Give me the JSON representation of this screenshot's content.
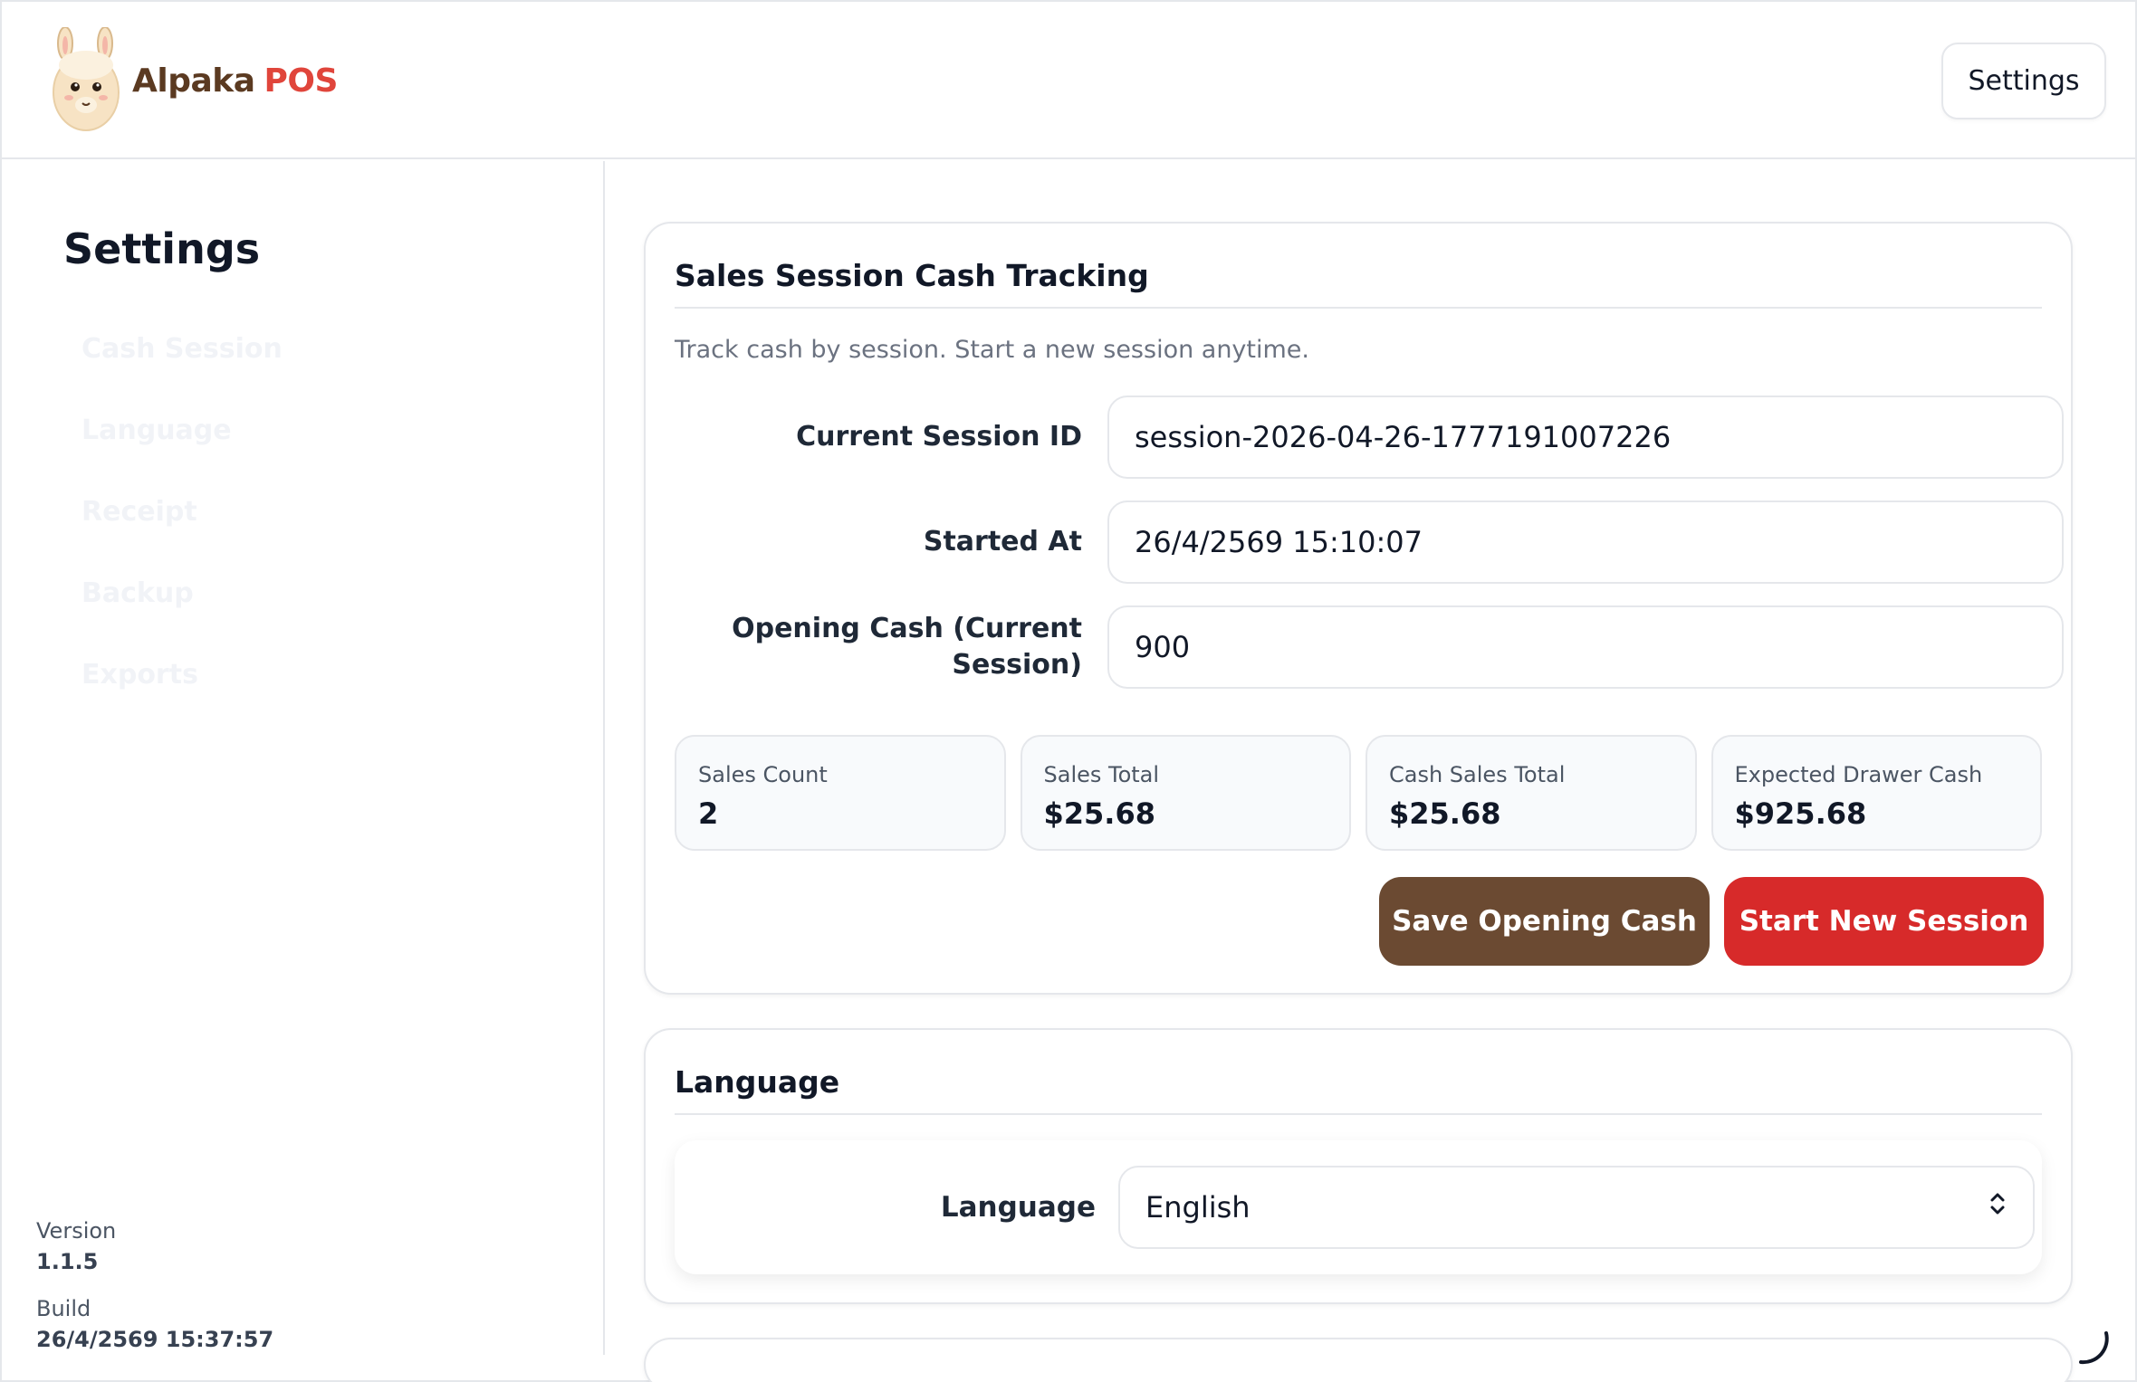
{
  "header": {
    "brand_primary": "Alpaka",
    "brand_secondary": "POS",
    "settings_button": "Settings"
  },
  "sidebar": {
    "title": "Settings",
    "items": [
      {
        "label": "Cash Session"
      },
      {
        "label": "Language"
      },
      {
        "label": "Receipt"
      },
      {
        "label": "Backup"
      },
      {
        "label": "Exports"
      }
    ],
    "version_label": "Version",
    "version_value": "1.1.5",
    "build_label": "Build",
    "build_value": "26/4/2569 15:37:57"
  },
  "cash_session": {
    "title": "Sales Session Cash Tracking",
    "description": "Track cash by session. Start a new session anytime.",
    "fields": {
      "session_id_label": "Current Session ID",
      "session_id_value": "session-2026-04-26-1777191007226",
      "started_at_label": "Started At",
      "started_at_value": "26/4/2569 15:10:07",
      "opening_cash_label": "Opening Cash (Current Session)",
      "opening_cash_value": "900"
    },
    "stats": [
      {
        "label": "Sales Count",
        "value": "2"
      },
      {
        "label": "Sales Total",
        "value": "$25.68"
      },
      {
        "label": "Cash Sales Total",
        "value": "$25.68"
      },
      {
        "label": "Expected Drawer Cash",
        "value": "$925.68"
      }
    ],
    "save_button": "Save Opening Cash",
    "start_button": "Start New Session"
  },
  "language_section": {
    "title": "Language",
    "label": "Language",
    "selected": "English"
  },
  "colors": {
    "save_button": "#6b4a32",
    "start_button": "#d72a2a",
    "brand_dark": "#5b3a21",
    "brand_accent": "#e0453b"
  }
}
